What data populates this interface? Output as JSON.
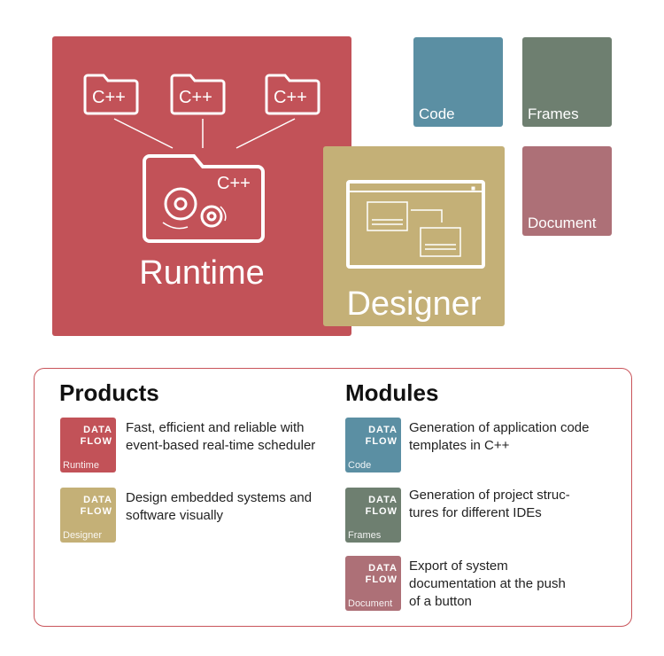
{
  "colors": {
    "runtime": "#c25258",
    "designer": "#c4b077",
    "code": "#5b8fa3",
    "frames": "#6e7f70",
    "document": "#ad7077",
    "panel_border": "#c9545a"
  },
  "runtime": {
    "label": "Runtime",
    "folder_labels": [
      "C++",
      "C++",
      "C++"
    ],
    "main_folder_label": "C++"
  },
  "designer": {
    "label": "Designer"
  },
  "modules_tiles": {
    "code": "Code",
    "frames": "Frames",
    "document": "Document"
  },
  "legend": {
    "products_heading": "Products",
    "modules_heading": "Modules",
    "badge_line1": "DATA",
    "badge_line2": "FLOW",
    "products": [
      {
        "name": "Runtime",
        "desc": "Fast, efficient and reliable with event-based real-time scheduler"
      },
      {
        "name": "Designer",
        "desc": "Design embedded systems and software visually"
      }
    ],
    "modules": [
      {
        "name": "Code",
        "desc": "Generation of application code templates in C++"
      },
      {
        "name": "Frames",
        "desc": "Generation of project struc­tures for different IDEs"
      },
      {
        "name": "Document",
        "desc": "Export of system documentation at the push of a button"
      }
    ]
  }
}
